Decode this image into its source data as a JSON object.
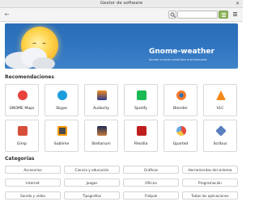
{
  "window": {
    "title": "Gestor de software"
  },
  "toolbar": {
    "search_value": ""
  },
  "banner": {
    "title": "Gnome-weather",
    "subtitle": "Access current conditions and forecasts"
  },
  "sections": {
    "recommendations": "Recomendaciones",
    "categories": "Categorías"
  },
  "apps": [
    {
      "label": "GNOME Maps"
    },
    {
      "label": "Skype"
    },
    {
      "label": "Audacity"
    },
    {
      "label": "Spotify"
    },
    {
      "label": "Blender"
    },
    {
      "label": "VLC"
    },
    {
      "label": "Gimp"
    },
    {
      "label": "Sublime"
    },
    {
      "label": "Stellarium"
    },
    {
      "label": "Filezilla"
    },
    {
      "label": "Gparted"
    },
    {
      "label": "Scribus"
    }
  ],
  "categories": [
    {
      "label": "Accesorios"
    },
    {
      "label": "Ciencia y educación"
    },
    {
      "label": "Gráficos"
    },
    {
      "label": "Herramientas del sistema"
    },
    {
      "label": "Internet"
    },
    {
      "label": "Juegos"
    },
    {
      "label": "Oficina"
    },
    {
      "label": "Programación"
    },
    {
      "label": "Sonido y vídeo"
    },
    {
      "label": "Tipografías"
    },
    {
      "label": "Flatpak"
    },
    {
      "label": "Todas las aplicaciones"
    }
  ],
  "colors": {
    "accent": "#8fb55e",
    "banner": "#2f74bf"
  }
}
